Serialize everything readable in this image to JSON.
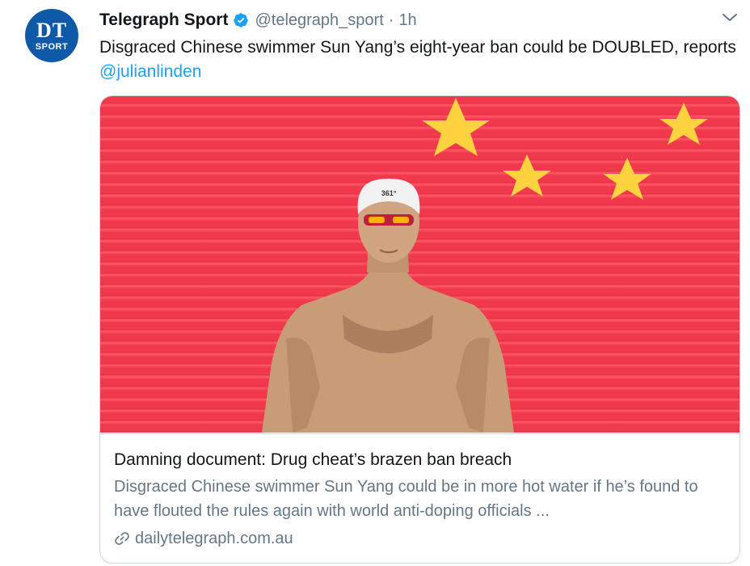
{
  "avatar": {
    "text_top": "DT",
    "text_bottom": "SPORT",
    "color": "#0f5aa8"
  },
  "header": {
    "name": "Telegraph Sport",
    "handle": "@telegraph_sport",
    "separator": "·",
    "time": "1h",
    "verified_icon": "verified-badge-icon",
    "menu_icon": "chevron-down-icon"
  },
  "tweet": {
    "text": "Disgraced Chinese swimmer Sun Yang’s eight-year ban could be DOUBLED, reports ",
    "mention": "@julianlinden"
  },
  "card": {
    "cap_text": "361°",
    "title": "Damning document: Drug cheat’s brazen ban breach",
    "description": "Disgraced Chinese swimmer Sun Yang could be in more hot water if he’s found to have flouted the rules again with world anti-doping officials ...",
    "domain": "dailytelegraph.com.au",
    "link_icon": "link-icon"
  },
  "colors": {
    "accent": "#1da1f2",
    "secondary_text": "#657786",
    "flag_red": "#f0394d",
    "flag_star": "#ffd23f"
  }
}
